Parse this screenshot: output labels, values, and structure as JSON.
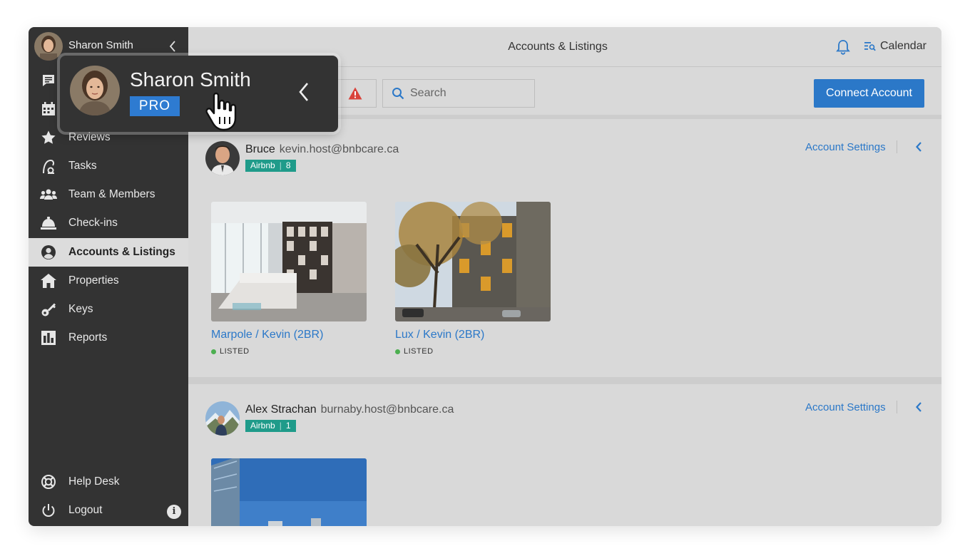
{
  "user": {
    "name": "Sharon Smith",
    "plan": "PRO"
  },
  "sidebar": {
    "items": [
      {
        "label": "",
        "icon": "messages-icon"
      },
      {
        "label": "",
        "icon": "calendar-icon"
      },
      {
        "label": "Reviews",
        "icon": "star-icon"
      },
      {
        "label": "Tasks",
        "icon": "vacuum-icon"
      },
      {
        "label": "Team & Members",
        "icon": "team-icon"
      },
      {
        "label": "Check-ins",
        "icon": "bell-service-icon"
      },
      {
        "label": "Accounts & Listings",
        "icon": "user-circle-icon",
        "active": true
      },
      {
        "label": "Properties",
        "icon": "home-icon"
      },
      {
        "label": "Keys",
        "icon": "key-icon"
      },
      {
        "label": "Reports",
        "icon": "chart-icon"
      }
    ],
    "bottom": [
      {
        "label": "Help Desk",
        "icon": "lifebuoy-icon"
      },
      {
        "label": "Logout",
        "icon": "power-icon"
      }
    ],
    "info_glyph": "i"
  },
  "topbar": {
    "title": "Accounts & Listings",
    "calendar_label": "Calendar"
  },
  "toolbar": {
    "search_placeholder": "Search",
    "connect_label": "Connect Account"
  },
  "accounts": [
    {
      "name": "Bruce",
      "email": "kevin.host@bnbcare.ca",
      "platform": "Airbnb",
      "count": "8",
      "settings_label": "Account Settings",
      "listings": [
        {
          "title": "Marpole / Kevin (2BR)",
          "status": "LISTED"
        },
        {
          "title": "Lux / Kevin (2BR)",
          "status": "LISTED"
        }
      ]
    },
    {
      "name": "Alex Strachan",
      "email": "burnaby.host@bnbcare.ca",
      "platform": "Airbnb",
      "count": "1",
      "settings_label": "Account Settings",
      "listings": [
        {
          "title": "",
          "status": ""
        }
      ]
    }
  ],
  "colors": {
    "accent": "#2b78c8",
    "sidebar": "#333333",
    "badge": "#1f9b8a",
    "alert": "#d9433b",
    "listed": "#4caf50"
  }
}
